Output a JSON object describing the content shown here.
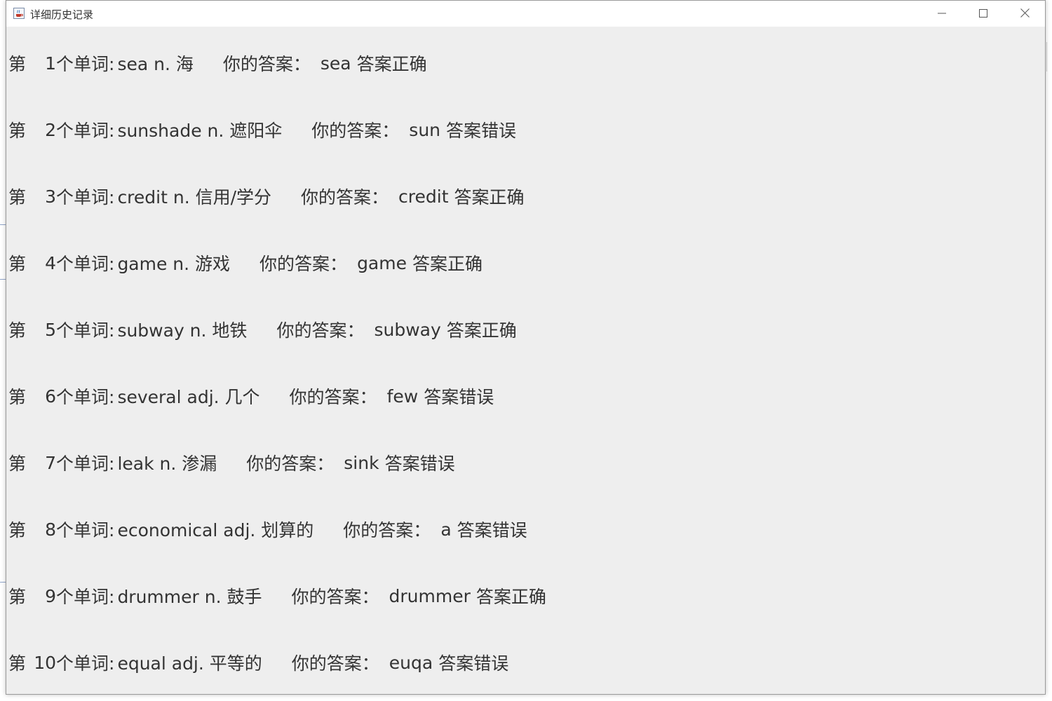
{
  "window": {
    "title": "详细历史记录",
    "app_icon": "java-cup-icon",
    "controls": [
      "minimize-icon",
      "maximize-icon",
      "close-icon"
    ]
  },
  "records": [
    {
      "prefix": "第",
      "number": "1",
      "unit": "个单词:",
      "word": "sea n. 海",
      "your_answer_label": "你的答案：",
      "answer": "sea",
      "result": "答案正确"
    },
    {
      "prefix": "第",
      "number": "2",
      "unit": "个单词:",
      "word": "sunshade n. 遮阳伞",
      "your_answer_label": "你的答案：",
      "answer": "sun",
      "result": "答案错误"
    },
    {
      "prefix": "第",
      "number": "3",
      "unit": "个单词:",
      "word": "credit n. 信用/学分",
      "your_answer_label": "你的答案：",
      "answer": "credit",
      "result": "答案正确"
    },
    {
      "prefix": "第",
      "number": "4",
      "unit": "个单词:",
      "word": "game n. 游戏",
      "your_answer_label": "你的答案：",
      "answer": "game",
      "result": "答案正确"
    },
    {
      "prefix": "第",
      "number": "5",
      "unit": "个单词:",
      "word": "subway n. 地铁",
      "your_answer_label": "你的答案：",
      "answer": "subway",
      "result": "答案正确"
    },
    {
      "prefix": "第",
      "number": "6",
      "unit": "个单词:",
      "word": "several adj. 几个",
      "your_answer_label": "你的答案：",
      "answer": "few",
      "result": "答案错误"
    },
    {
      "prefix": "第",
      "number": "7",
      "unit": "个单词:",
      "word": "leak n. 渗漏",
      "your_answer_label": "你的答案：",
      "answer": "sink",
      "result": "答案错误"
    },
    {
      "prefix": "第",
      "number": "8",
      "unit": "个单词:",
      "word": "economical adj. 划算的",
      "your_answer_label": "你的答案：",
      "answer": "a",
      "result": "答案错误"
    },
    {
      "prefix": "第",
      "number": "9",
      "unit": "个单词:",
      "word": "drummer n. 鼓手",
      "your_answer_label": "你的答案：",
      "answer": "drummer",
      "result": "答案正确"
    },
    {
      "prefix": "第",
      "number": "10",
      "unit": "个单词:",
      "word": "equal adj. 平等的",
      "your_answer_label": "你的答案：",
      "answer": "euqa",
      "result": "答案错误"
    }
  ]
}
